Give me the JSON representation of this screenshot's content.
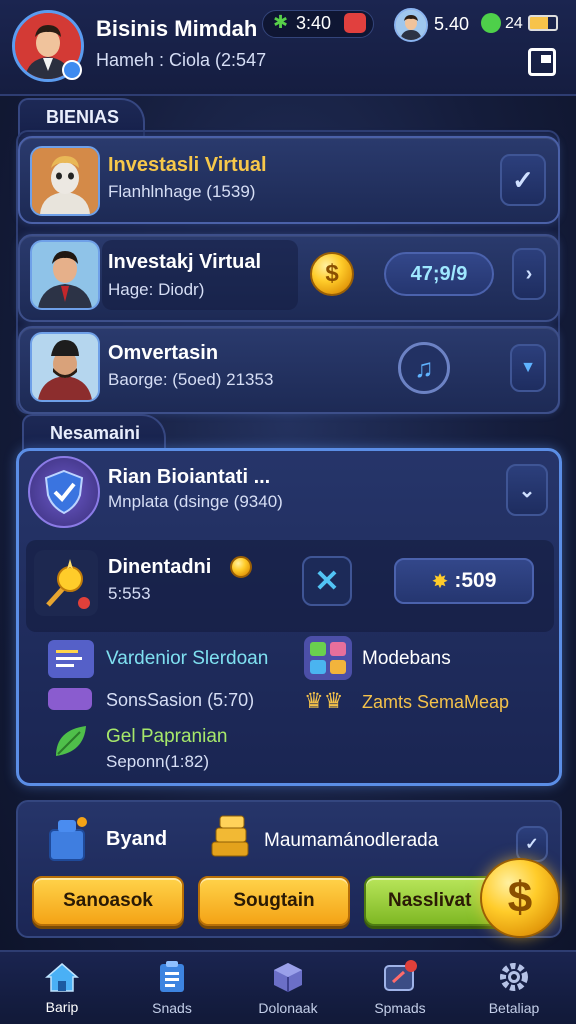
{
  "header": {
    "title": "Bisinis Mimdah",
    "subtitle": "Hameh : Ciola (2:547",
    "stat_left_value": "3:40",
    "stat_left_icon": "leaf-icon",
    "stat_mid_value": "5.40",
    "stat_right_value": "24"
  },
  "section1": {
    "tab": "BIENIAS",
    "rows": [
      {
        "title": "Investasli Virtual",
        "sub": "Flanhlnhage (1539)",
        "title_color": "#f7c84a"
      },
      {
        "title": "Investakj Virtual",
        "sub": "Hage: Diodr)",
        "value": "47;9/9"
      },
      {
        "title": "Omvertasin",
        "sub": "Baorge: (5oed) 21353"
      }
    ]
  },
  "section2": {
    "tab": "Nesamaini",
    "header_title": "Rian Bioiantati ...",
    "header_sub": "Mnplata (dsinge (9340)",
    "reward": {
      "title": "Dinentadni",
      "sub": "5:553",
      "value": ":509"
    },
    "stats": [
      {
        "label": "Vardenior Slerdoan",
        "color": "#7fe0f0"
      },
      {
        "label": "Modebans",
        "color": "#ffffff"
      },
      {
        "label": "SonsSasion (5:70)",
        "color": "#d6def5"
      },
      {
        "label": "Zamts SemaMeap",
        "color": "#f4c24a"
      },
      {
        "label": "Gel Papranian",
        "color": "#a6e86a"
      },
      {
        "label": "Seponn(1:82)",
        "color": "#d6def5"
      }
    ]
  },
  "bottom_panel": {
    "item1": "Byand",
    "item2": "Maumamánodlerada",
    "buttons": [
      "Sanoasok",
      "Sougtain",
      "Nasslivat"
    ]
  },
  "nav": [
    {
      "label": "Barip",
      "icon": "home-icon"
    },
    {
      "label": "Snads",
      "icon": "clipboard-icon"
    },
    {
      "label": "Dolonaak",
      "icon": "cube-icon"
    },
    {
      "label": "Spmads",
      "icon": "chat-icon"
    },
    {
      "label": "Betaliap",
      "icon": "gear-icon"
    }
  ],
  "colors": {
    "accent": "#f4a316",
    "panel": "#2a3a6d",
    "border": "#3d4f8a"
  }
}
